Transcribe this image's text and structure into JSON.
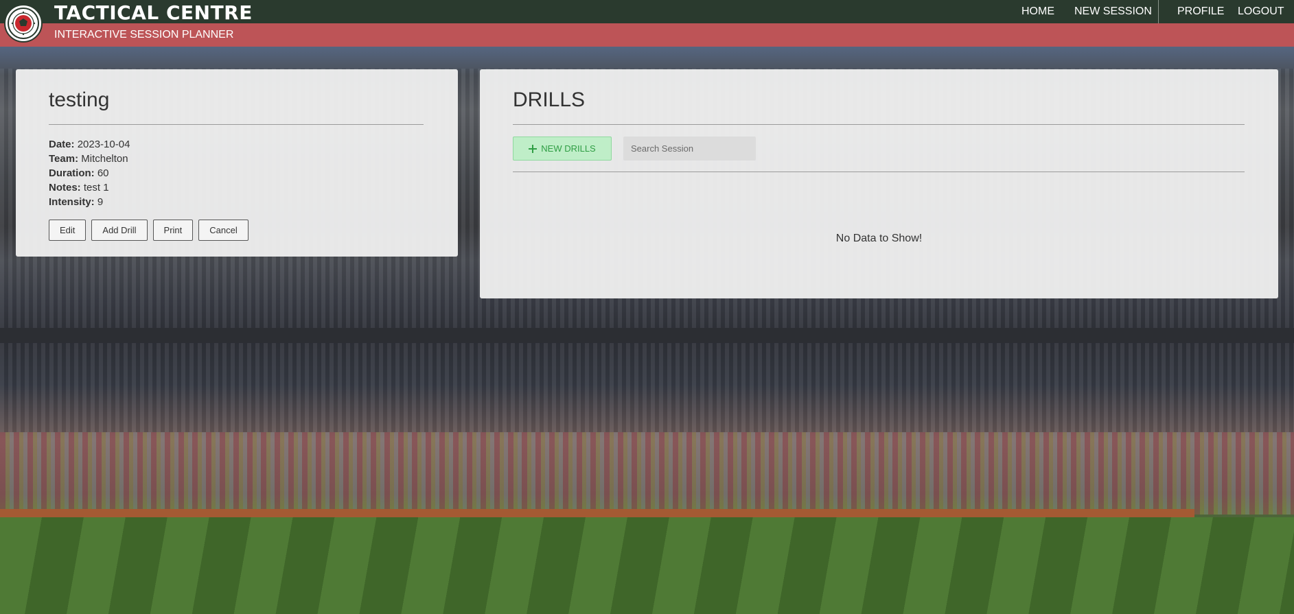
{
  "header": {
    "title": "TACTICAL CENTRE",
    "subtitle": "INTERACTIVE SESSION PLANNER",
    "logo_text": "TACTICAL CENTRE",
    "brand_color": "#2a3a2e",
    "accent_color": "#bd5457"
  },
  "nav": {
    "home": "HOME",
    "new_session": "NEW SESSION",
    "profile": "PROFILE",
    "logout": "LOGOUT"
  },
  "session": {
    "name": "testing",
    "details": [
      {
        "label": "Date:",
        "value": "2023-10-04"
      },
      {
        "label": "Team:",
        "value": "Mitchelton"
      },
      {
        "label": "Duration:",
        "value": "60"
      },
      {
        "label": "Notes:",
        "value": "test 1"
      },
      {
        "label": "Intensity:",
        "value": "9"
      }
    ],
    "buttons": {
      "edit": "Edit",
      "add_drill": "Add Drill",
      "print": "Print",
      "cancel": "Cancel"
    }
  },
  "drills": {
    "heading": "DRILLS",
    "new_button": "NEW DRILLS",
    "new_button_icon": "plus-icon",
    "search_placeholder": "Search Session",
    "search_value": "",
    "empty_message": "No Data to Show!",
    "new_button_color": "#2f9e44"
  }
}
